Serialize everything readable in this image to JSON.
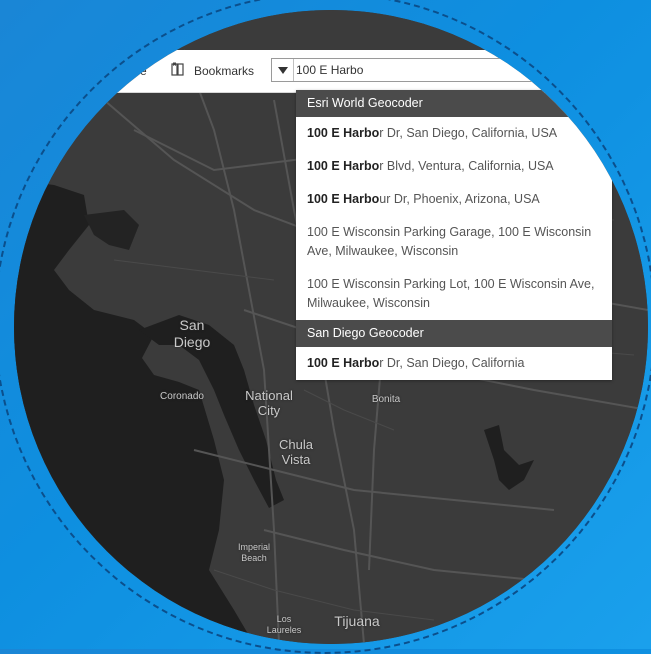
{
  "toolbar": {
    "share_label_fragment": "re",
    "bookmarks_label": "Bookmarks",
    "search_value": "100 E Harbo"
  },
  "suggestions": {
    "group1_title": "Esri World Geocoder",
    "group1_items": [
      {
        "match": "100 E Harbo",
        "rest": "r Dr, San Diego, California, USA"
      },
      {
        "match": "100 E Harbo",
        "rest": "r Blvd, Ventura, California, USA"
      },
      {
        "match": "100 E Harbo",
        "rest": "ur Dr, Phoenix, Arizona, USA"
      },
      {
        "match": "",
        "rest": "100 E Wisconsin Parking Garage, 100 E Wisconsin Ave, Milwaukee, Wisconsin"
      },
      {
        "match": "",
        "rest": "100 E Wisconsin Parking Lot, 100 E Wisconsin Ave, Milwaukee, Wisconsin"
      }
    ],
    "group2_title": "San Diego Geocoder",
    "group2_items": [
      {
        "match": "100 E Harbo",
        "rest": "r Dr, San Diego, California"
      }
    ]
  },
  "map_labels": {
    "san_diego": "San\nDiego",
    "coronado": "Coronado",
    "national_city": "National\nCity",
    "bonita": "Bonita",
    "chula_vista": "Chula\nVista",
    "imperial_beach": "Imperial\nBeach",
    "los_laureles": "Los\nLaureles",
    "tijuana": "Tijuana"
  },
  "icons": {
    "bookmarks": "bookmarks-icon",
    "dropdown": "caret-down-icon"
  },
  "colors": {
    "map_land": "#3a3a3a",
    "map_water": "#1e1e1e",
    "background": "#0e8fe0",
    "header_bar": "#4b4b4b"
  }
}
